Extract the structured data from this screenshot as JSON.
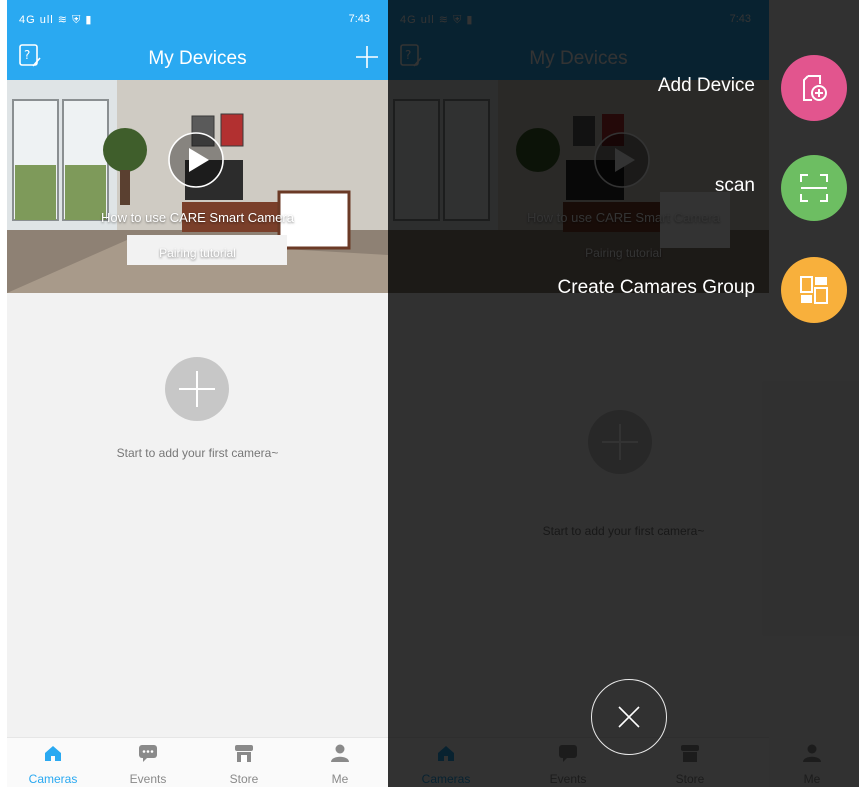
{
  "status": {
    "left": "4G ull ≋ ⛨ ▮",
    "time": "7:43"
  },
  "header": {
    "title": "My Devices"
  },
  "banner": {
    "title": "How to use CARE Smart Camera",
    "subtitle": "Pairing tutorial"
  },
  "empty": {
    "text": "Start to add your first camera~"
  },
  "tabs": [
    {
      "label": "Cameras",
      "icon": "home-icon",
      "active": true
    },
    {
      "label": "Events",
      "icon": "chat-icon",
      "active": false
    },
    {
      "label": "Store",
      "icon": "store-icon",
      "active": false
    },
    {
      "label": "Me",
      "icon": "person-icon",
      "active": false
    }
  ],
  "menu": [
    {
      "label": "Add Device",
      "icon": "add-device-icon",
      "color": "#e2558e"
    },
    {
      "label": "scan",
      "icon": "scan-icon",
      "color": "#6dbe62"
    },
    {
      "label": "Create Camares Group",
      "icon": "group-icon",
      "color": "#f8b03c"
    }
  ],
  "colors": {
    "accent": "#2aa9f1",
    "inactive": "#8a8a8a"
  }
}
